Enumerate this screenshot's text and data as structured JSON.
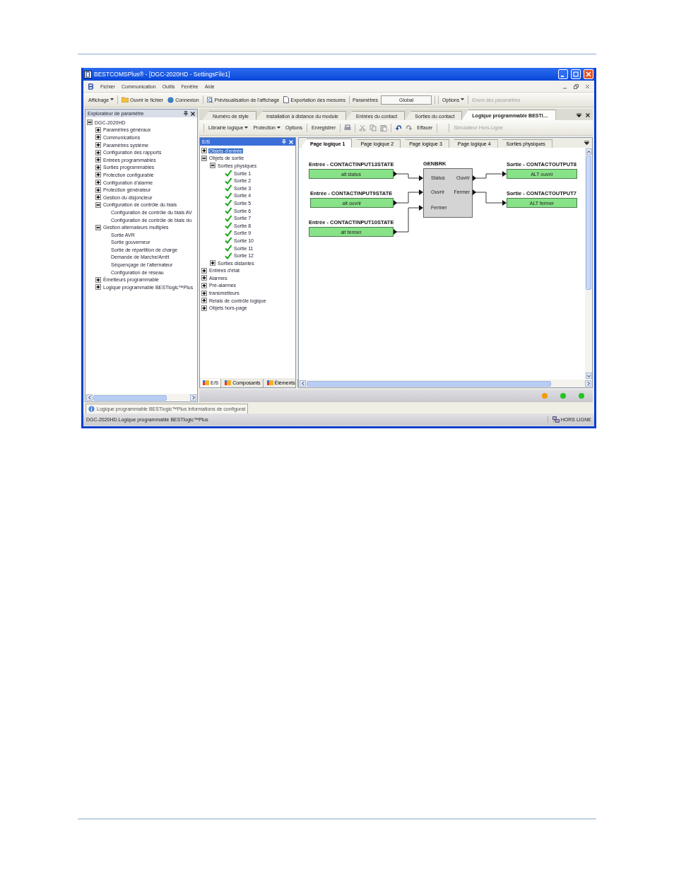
{
  "window": {
    "title": "BESTCOMSPlus® - [DGC-2020HD - SettingsFile1]"
  },
  "menu": [
    "Fichier",
    "Communication",
    "Outils",
    "Fenêtre",
    "Aide"
  ],
  "toolbar": {
    "view": "Affichage",
    "open": "Ouvrir le fichier",
    "connect": "Connexion",
    "preview": "Prévisualisation de l'affichage",
    "export": "Exportation des mesures",
    "settings_label": "Paramètres",
    "settings_value": "Global",
    "options": "Options",
    "send": {
      "label": "Envoi des paramètres",
      "disabled": true
    }
  },
  "explorer": {
    "title": "Explorateur de paramètre",
    "tree": [
      {
        "label": "DGC-2020HD",
        "expanded": true,
        "children": [
          {
            "label": "Paramètres généraux",
            "expanded": false
          },
          {
            "label": "Communications",
            "expanded": false
          },
          {
            "label": "Paramètres système",
            "expanded": false
          },
          {
            "label": "Configuration des rapports",
            "expanded": false
          },
          {
            "label": "Entrées programmables",
            "expanded": false
          },
          {
            "label": "Sorties programmables",
            "expanded": false
          },
          {
            "label": "Protection configurable",
            "expanded": false
          },
          {
            "label": "Configuration d'alarme",
            "expanded": false
          },
          {
            "label": "Protection générateur",
            "expanded": false
          },
          {
            "label": "Gestion du disjoncteur",
            "expanded": false
          },
          {
            "label": "Configuration de contrôle du biais",
            "expanded": true,
            "children": [
              {
                "label": "Configuration de contrôle du biais AV"
              },
              {
                "label": "Configuration de contrôle de biais du"
              }
            ]
          },
          {
            "label": "Gestion alternateurs multiples",
            "expanded": true,
            "children": [
              {
                "label": "Sortie AVR"
              },
              {
                "label": "Sortie gouverneur"
              },
              {
                "label": "Sortie de répartition de charge"
              },
              {
                "label": "Demande de Marche/Arrêt"
              },
              {
                "label": "Séquençage de l'alternateur"
              },
              {
                "label": "Configuration de réseau"
              }
            ]
          },
          {
            "label": "Émetteurs programmable",
            "expanded": false
          },
          {
            "label": "Logique programmable BESTlogic™Plus",
            "expanded": false
          }
        ]
      }
    ]
  },
  "document_tabs": [
    {
      "label": "Numéro de style",
      "selected": false
    },
    {
      "label": "Installation à distance du module",
      "selected": false
    },
    {
      "label": "Entrées du contact",
      "selected": false
    },
    {
      "label": "Sorties du contact",
      "selected": false
    },
    {
      "label": "Logique programmable BESTI…",
      "selected": true
    }
  ],
  "logic_toolbar": {
    "library": "Librairie logique",
    "protection": "Protection",
    "options": "Options",
    "save": "Enregistrer",
    "clear": "Effacer",
    "simulator": {
      "label": "Simulateur Hors-Ligne",
      "disabled": true
    }
  },
  "io_panel": {
    "title": "E/S",
    "tree": [
      {
        "label": "Objets d'entrée",
        "expanded": false,
        "selected": true
      },
      {
        "label": "Objets de sortie",
        "expanded": true,
        "selected": false,
        "children": [
          {
            "label": "Sorties physiques",
            "expanded": true,
            "selected": false,
            "children": [
              {
                "label": "Sortie 1",
                "checked": true,
                "selected": false
              },
              {
                "label": "Sortie 2",
                "checked": true,
                "selected": false
              },
              {
                "label": "Sortie 3",
                "checked": true,
                "selected": false
              },
              {
                "label": "Sortie 4",
                "checked": true,
                "selected": false
              },
              {
                "label": "Sortie 5",
                "checked": true,
                "selected": false
              },
              {
                "label": "Sortie 6",
                "checked": true,
                "selected": false
              },
              {
                "label": "Sortie 7",
                "checked": true,
                "selected": false
              },
              {
                "label": "Sortie 8",
                "checked": true,
                "selected": false
              },
              {
                "label": "Sortie 9",
                "checked": true,
                "selected": false
              },
              {
                "label": "Sortie 10",
                "checked": true,
                "selected": false
              },
              {
                "label": "Sortie 11",
                "checked": true,
                "selected": false
              },
              {
                "label": "Sortie 12",
                "checked": true,
                "selected": false
              }
            ]
          },
          {
            "label": "Sorties distantes",
            "expanded": false,
            "selected": false
          }
        ]
      },
      {
        "label": "Entrées d'état",
        "expanded": false,
        "selected": false
      },
      {
        "label": "Alarmes",
        "expanded": false,
        "selected": false
      },
      {
        "label": "Pré-alarmes",
        "expanded": false,
        "selected": false
      },
      {
        "label": "transmetteurs",
        "expanded": false,
        "selected": false
      },
      {
        "label": "Relais de contrôle logique",
        "expanded": false,
        "selected": false
      },
      {
        "label": "Objets hors-page",
        "expanded": false,
        "selected": false
      }
    ],
    "tabs": [
      {
        "label": "E/S",
        "selected": true
      },
      {
        "label": "Composants",
        "selected": false
      },
      {
        "label": "Éléments",
        "selected": false
      }
    ]
  },
  "page_tabs": [
    {
      "label": "Page logique 1",
      "selected": true
    },
    {
      "label": "Page logique 2",
      "selected": false
    },
    {
      "label": "Page logique 3",
      "selected": false
    },
    {
      "label": "Page logique 4",
      "selected": false
    },
    {
      "label": "Sorties physiques",
      "selected": false
    }
  ],
  "diagram": {
    "inputs": [
      {
        "title": "Entrée - CONTACTINPUT13STATE",
        "name": "alt status"
      },
      {
        "title": "Entrée - CONTACTINPUT9STATE",
        "name": "alt ouvrir"
      },
      {
        "title": "Entrée - CONTACTINPUT10STATE",
        "name": "alt fermer"
      }
    ],
    "block": {
      "title": "GENBRK",
      "inputs": [
        "Status",
        "Ouvrir",
        "Fermer"
      ],
      "outputs": [
        "Ouvrir",
        "Fermer"
      ]
    },
    "outputs": [
      {
        "title": "Sortie - CONTACTOUTPUT8",
        "name": "ALT ouvrir"
      },
      {
        "title": "Sortie - CONTACTOUTPUT7",
        "name": "ALT fermer"
      }
    ]
  },
  "status_leds": [
    {
      "color": "#f09a10"
    },
    {
      "color": "#22c422"
    },
    {
      "color": "#22c422"
    }
  ],
  "info_tab": "Logique programmable BESTlogic™Plus Informations de configurat",
  "status_bar": {
    "path": "DGC-2020HD.Logique programmable BESTlogic™Plus",
    "connection": "HORS LIGNE"
  }
}
